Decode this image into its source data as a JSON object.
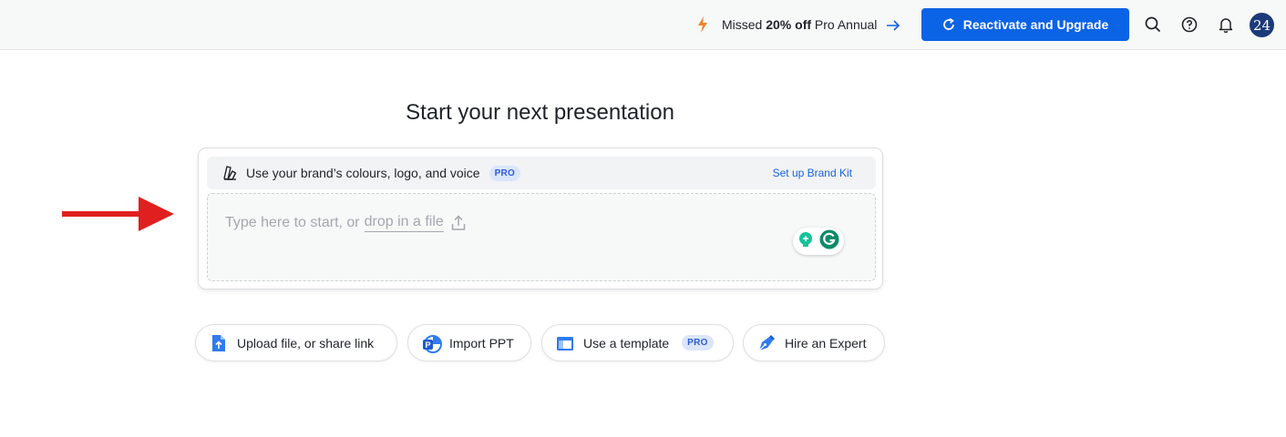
{
  "topbar": {
    "promo_text_prefix": "Missed ",
    "promo_text_bold": "20% off",
    "promo_text_suffix": " Pro Annual",
    "cta_label": "Reactivate and Upgrade",
    "avatar_text": "24",
    "icons": [
      "bolt-icon",
      "arrow-right-icon",
      "refresh-icon",
      "search-icon",
      "help-icon",
      "bell-icon"
    ],
    "accent_color": "#0b63e5"
  },
  "main": {
    "heading": "Start your next presentation",
    "brand_kit": {
      "label": "Use your brand’s colours, logo, and voice",
      "badge": "PRO",
      "link": "Set up Brand Kit"
    },
    "input": {
      "placeholder_prefix": "Type here to start, or",
      "drop_link": "drop in a file"
    }
  },
  "actions": [
    {
      "label": "Upload file, or share link",
      "icon": "upload-file-icon"
    },
    {
      "label": "Import PPT",
      "icon": "powerpoint-icon"
    },
    {
      "label": "Use a template",
      "icon": "template-icon",
      "badge": "PRO"
    },
    {
      "label": "Hire an Expert",
      "icon": "pen-nib-icon"
    }
  ],
  "annotation_color": "#e02020"
}
